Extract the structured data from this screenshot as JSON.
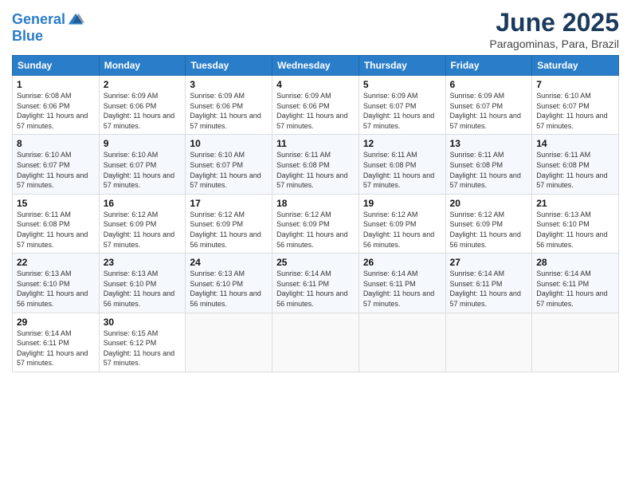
{
  "logo": {
    "line1": "General",
    "line2": "Blue"
  },
  "title": "June 2025",
  "location": "Paragominas, Para, Brazil",
  "days_of_week": [
    "Sunday",
    "Monday",
    "Tuesday",
    "Wednesday",
    "Thursday",
    "Friday",
    "Saturday"
  ],
  "weeks": [
    [
      {
        "day": "1",
        "sunrise": "6:08 AM",
        "sunset": "6:06 PM",
        "daylight": "11 hours and 57 minutes."
      },
      {
        "day": "2",
        "sunrise": "6:09 AM",
        "sunset": "6:06 PM",
        "daylight": "11 hours and 57 minutes."
      },
      {
        "day": "3",
        "sunrise": "6:09 AM",
        "sunset": "6:06 PM",
        "daylight": "11 hours and 57 minutes."
      },
      {
        "day": "4",
        "sunrise": "6:09 AM",
        "sunset": "6:06 PM",
        "daylight": "11 hours and 57 minutes."
      },
      {
        "day": "5",
        "sunrise": "6:09 AM",
        "sunset": "6:07 PM",
        "daylight": "11 hours and 57 minutes."
      },
      {
        "day": "6",
        "sunrise": "6:09 AM",
        "sunset": "6:07 PM",
        "daylight": "11 hours and 57 minutes."
      },
      {
        "day": "7",
        "sunrise": "6:10 AM",
        "sunset": "6:07 PM",
        "daylight": "11 hours and 57 minutes."
      }
    ],
    [
      {
        "day": "8",
        "sunrise": "6:10 AM",
        "sunset": "6:07 PM",
        "daylight": "11 hours and 57 minutes."
      },
      {
        "day": "9",
        "sunrise": "6:10 AM",
        "sunset": "6:07 PM",
        "daylight": "11 hours and 57 minutes."
      },
      {
        "day": "10",
        "sunrise": "6:10 AM",
        "sunset": "6:07 PM",
        "daylight": "11 hours and 57 minutes."
      },
      {
        "day": "11",
        "sunrise": "6:11 AM",
        "sunset": "6:08 PM",
        "daylight": "11 hours and 57 minutes."
      },
      {
        "day": "12",
        "sunrise": "6:11 AM",
        "sunset": "6:08 PM",
        "daylight": "11 hours and 57 minutes."
      },
      {
        "day": "13",
        "sunrise": "6:11 AM",
        "sunset": "6:08 PM",
        "daylight": "11 hours and 57 minutes."
      },
      {
        "day": "14",
        "sunrise": "6:11 AM",
        "sunset": "6:08 PM",
        "daylight": "11 hours and 57 minutes."
      }
    ],
    [
      {
        "day": "15",
        "sunrise": "6:11 AM",
        "sunset": "6:08 PM",
        "daylight": "11 hours and 57 minutes."
      },
      {
        "day": "16",
        "sunrise": "6:12 AM",
        "sunset": "6:09 PM",
        "daylight": "11 hours and 57 minutes."
      },
      {
        "day": "17",
        "sunrise": "6:12 AM",
        "sunset": "6:09 PM",
        "daylight": "11 hours and 56 minutes."
      },
      {
        "day": "18",
        "sunrise": "6:12 AM",
        "sunset": "6:09 PM",
        "daylight": "11 hours and 56 minutes."
      },
      {
        "day": "19",
        "sunrise": "6:12 AM",
        "sunset": "6:09 PM",
        "daylight": "11 hours and 56 minutes."
      },
      {
        "day": "20",
        "sunrise": "6:12 AM",
        "sunset": "6:09 PM",
        "daylight": "11 hours and 56 minutes."
      },
      {
        "day": "21",
        "sunrise": "6:13 AM",
        "sunset": "6:10 PM",
        "daylight": "11 hours and 56 minutes."
      }
    ],
    [
      {
        "day": "22",
        "sunrise": "6:13 AM",
        "sunset": "6:10 PM",
        "daylight": "11 hours and 56 minutes."
      },
      {
        "day": "23",
        "sunrise": "6:13 AM",
        "sunset": "6:10 PM",
        "daylight": "11 hours and 56 minutes."
      },
      {
        "day": "24",
        "sunrise": "6:13 AM",
        "sunset": "6:10 PM",
        "daylight": "11 hours and 56 minutes."
      },
      {
        "day": "25",
        "sunrise": "6:14 AM",
        "sunset": "6:11 PM",
        "daylight": "11 hours and 56 minutes."
      },
      {
        "day": "26",
        "sunrise": "6:14 AM",
        "sunset": "6:11 PM",
        "daylight": "11 hours and 57 minutes."
      },
      {
        "day": "27",
        "sunrise": "6:14 AM",
        "sunset": "6:11 PM",
        "daylight": "11 hours and 57 minutes."
      },
      {
        "day": "28",
        "sunrise": "6:14 AM",
        "sunset": "6:11 PM",
        "daylight": "11 hours and 57 minutes."
      }
    ],
    [
      {
        "day": "29",
        "sunrise": "6:14 AM",
        "sunset": "6:11 PM",
        "daylight": "11 hours and 57 minutes."
      },
      {
        "day": "30",
        "sunrise": "6:15 AM",
        "sunset": "6:12 PM",
        "daylight": "11 hours and 57 minutes."
      },
      null,
      null,
      null,
      null,
      null
    ]
  ]
}
